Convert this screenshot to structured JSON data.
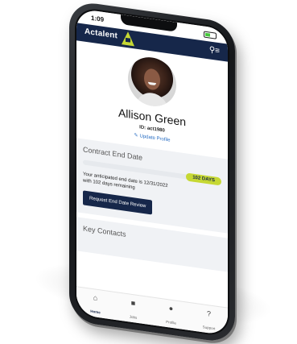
{
  "status": {
    "time": "1:09"
  },
  "app": {
    "brand": "Actalent",
    "menu_icon": "search-menu-icon"
  },
  "profile": {
    "name": "Allison Green",
    "id_label": "ID: act1980",
    "update_link": "Update Profile"
  },
  "contract": {
    "title": "Contract End Date",
    "days_badge": "102 DAYS",
    "line1": "Your anticipated end date is 12/31/2022",
    "line2": "with 102 days remaining",
    "button": "Request End Date Review",
    "progress_fraction": 0.85
  },
  "contacts": {
    "title": "Key Contacts"
  },
  "tabs": [
    {
      "label": "Home",
      "icon": "home-icon"
    },
    {
      "label": "Jobs",
      "icon": "briefcase-icon"
    },
    {
      "label": "Profile",
      "icon": "person-icon"
    },
    {
      "label": "Support",
      "icon": "help-icon"
    }
  ],
  "colors": {
    "navy": "#16274a",
    "accent": "#c6d833",
    "link": "#2a6fc4"
  }
}
